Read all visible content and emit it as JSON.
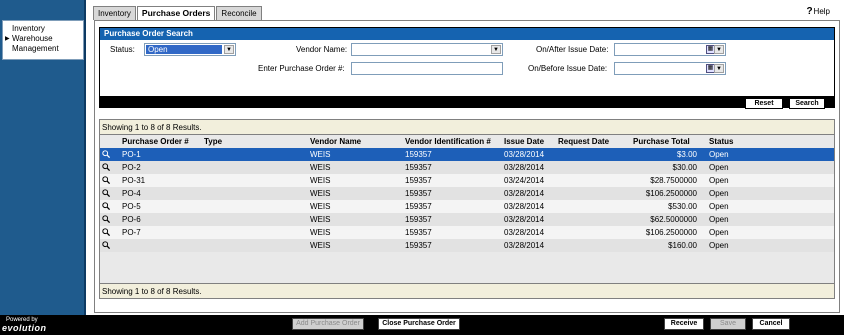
{
  "nav": {
    "items": [
      {
        "label": "Inventory"
      },
      {
        "label": "Warehouse"
      },
      {
        "label": "Management"
      }
    ]
  },
  "tabs": [
    "Inventory",
    "Purchase Orders",
    "Reconcile"
  ],
  "help_label": "Help",
  "search": {
    "title": "Purchase Order Search",
    "status_label": "Status:",
    "status_value": "Open",
    "vendor_label": "Vendor Name:",
    "vendor_value": "",
    "po_label": "Enter Purchase Order #:",
    "po_value": "",
    "after_label": "On/After Issue Date:",
    "before_label": "On/Before Issue Date:",
    "reset_label": "Reset",
    "search_label": "Search"
  },
  "results": {
    "summary_top": "Showing 1 to 8 of 8 Results.",
    "summary_bottom": "Showing 1 to 8 of 8 Results.",
    "columns": [
      "Purchase Order #",
      "Type",
      "Vendor Name",
      "Vendor Identification #",
      "Issue Date",
      "Request Date",
      "Purchase Total",
      "Status"
    ],
    "rows": [
      {
        "po": "PO-1",
        "type": "",
        "vendor": "WEIS",
        "vendor_id": "159357",
        "issue": "03/28/2014",
        "request": "",
        "total": "$3.00",
        "status": "Open"
      },
      {
        "po": "PO-2",
        "type": "",
        "vendor": "WEIS",
        "vendor_id": "159357",
        "issue": "03/28/2014",
        "request": "",
        "total": "$30.00",
        "status": "Open"
      },
      {
        "po": "PO-31",
        "type": "",
        "vendor": "WEIS",
        "vendor_id": "159357",
        "issue": "03/24/2014",
        "request": "",
        "total": "$28.7500000",
        "status": "Open"
      },
      {
        "po": "PO-4",
        "type": "",
        "vendor": "WEIS",
        "vendor_id": "159357",
        "issue": "03/28/2014",
        "request": "",
        "total": "$106.2500000",
        "status": "Open"
      },
      {
        "po": "PO-5",
        "type": "",
        "vendor": "WEIS",
        "vendor_id": "159357",
        "issue": "03/28/2014",
        "request": "",
        "total": "$530.00",
        "status": "Open"
      },
      {
        "po": "PO-6",
        "type": "",
        "vendor": "WEIS",
        "vendor_id": "159357",
        "issue": "03/28/2014",
        "request": "",
        "total": "$62.5000000",
        "status": "Open"
      },
      {
        "po": "PO-7",
        "type": "",
        "vendor": "WEIS",
        "vendor_id": "159357",
        "issue": "03/28/2014",
        "request": "",
        "total": "$106.2500000",
        "status": "Open"
      },
      {
        "po": "",
        "type": "",
        "vendor": "WEIS",
        "vendor_id": "159357",
        "issue": "03/28/2014",
        "request": "",
        "total": "$160.00",
        "status": "Open"
      }
    ]
  },
  "footer": {
    "powered_by": "Powered by",
    "brand": "evolution",
    "add_po": "Add Purchase Order",
    "close_po": "Close Purchase Order",
    "receive": "Receive",
    "save": "Save",
    "cancel": "Cancel"
  },
  "colors": {
    "nav_bg": "#1f5b8d",
    "title_bar": "#1563b0",
    "selected_row": "#1d5fb8"
  }
}
